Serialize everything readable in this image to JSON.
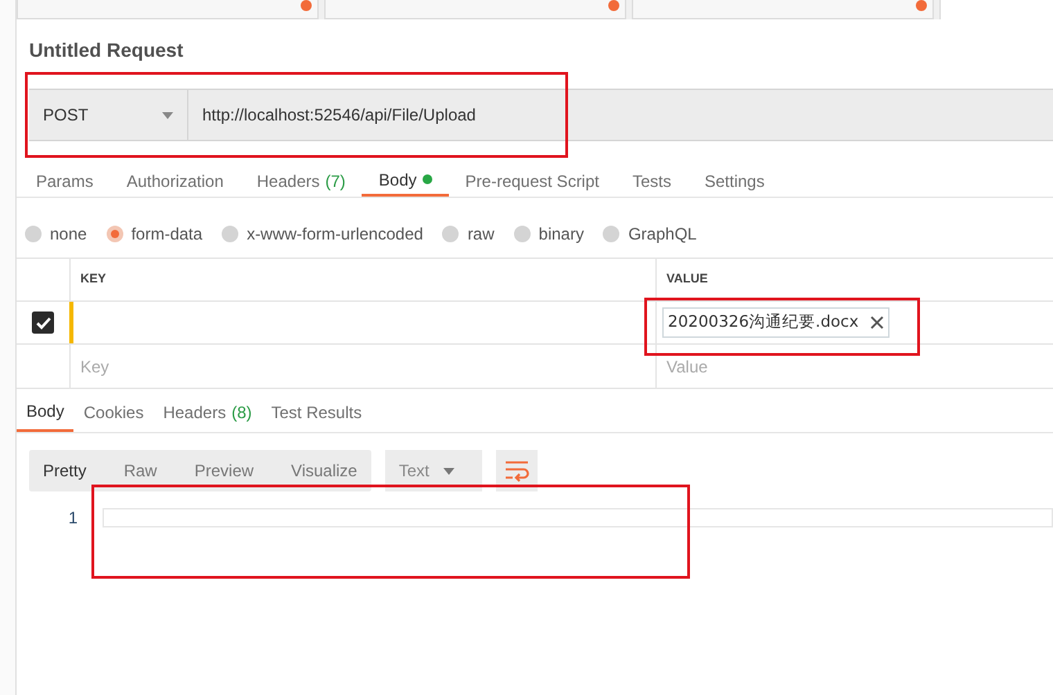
{
  "open_tabs": [
    {
      "unsaved": true,
      "selected": false
    },
    {
      "unsaved": true,
      "selected": false
    },
    {
      "unsaved": true,
      "selected": false
    },
    {
      "unsaved": false,
      "selected": true
    }
  ],
  "request": {
    "title": "Untitled Request",
    "method": "POST",
    "url": "http://localhost:52546/api/File/Upload"
  },
  "request_tabs": [
    {
      "label": "Params",
      "selected": false
    },
    {
      "label": "Authorization",
      "selected": false
    },
    {
      "label": "Headers",
      "count": "(7)",
      "selected": false
    },
    {
      "label": "Body",
      "dot": true,
      "selected": true
    },
    {
      "label": "Pre-request Script",
      "selected": false
    },
    {
      "label": "Tests",
      "selected": false
    },
    {
      "label": "Settings",
      "selected": false
    }
  ],
  "body_types": [
    {
      "label": "none",
      "selected": false
    },
    {
      "label": "form-data",
      "selected": true
    },
    {
      "label": "x-www-form-urlencoded",
      "selected": false
    },
    {
      "label": "raw",
      "selected": false
    },
    {
      "label": "binary",
      "selected": false
    },
    {
      "label": "GraphQL",
      "selected": false
    }
  ],
  "form_table": {
    "columns": [
      "KEY",
      "VALUE"
    ],
    "rows": [
      {
        "checked": true,
        "key": "",
        "file": "20200326沟通纪要.docx"
      }
    ],
    "new_row": {
      "key_placeholder": "Key",
      "value_placeholder": "Value"
    }
  },
  "response_tabs": [
    {
      "label": "Body",
      "selected": true
    },
    {
      "label": "Cookies",
      "selected": false
    },
    {
      "label": "Headers",
      "count": "(8)",
      "selected": false
    },
    {
      "label": "Test Results",
      "selected": false
    }
  ],
  "view_modes": [
    {
      "label": "Pretty",
      "selected": true
    },
    {
      "label": "Raw",
      "selected": false
    },
    {
      "label": "Preview",
      "selected": false
    },
    {
      "label": "Visualize",
      "selected": false
    }
  ],
  "format": "Text",
  "editor": {
    "line_numbers": [
      "1"
    ]
  }
}
